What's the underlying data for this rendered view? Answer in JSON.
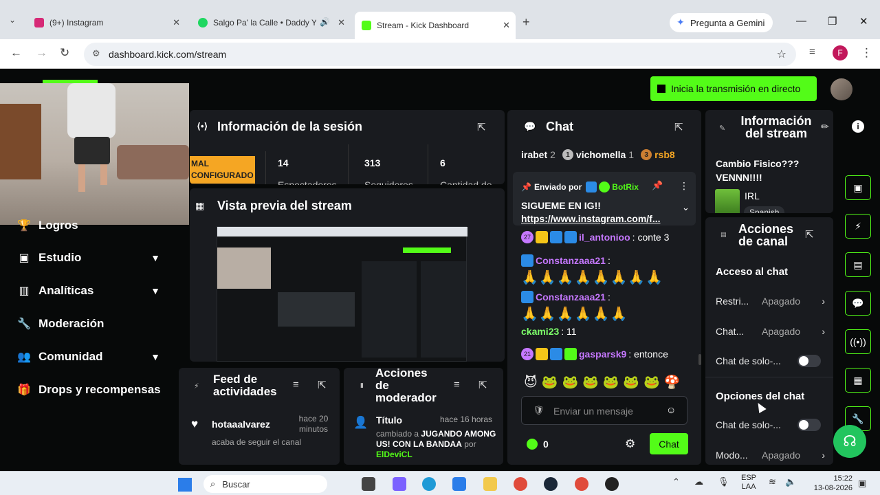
{
  "browser": {
    "tabs": [
      {
        "label": "(9+) Instagram",
        "color": "#d62976"
      },
      {
        "label": "Salgo Pa' la Calle • Daddy Y",
        "color": "#1ed760"
      },
      {
        "label": "Stream - Kick Dashboard",
        "color": "#53fc18"
      }
    ],
    "url": "dashboard.kick.com/stream",
    "gemini_label": "Pregunta a Gemini",
    "profile_initial": "F"
  },
  "header": {
    "go_live_label": "Inicia la transmisión en directo"
  },
  "sidebar": {
    "items": [
      {
        "label": "Logros",
        "icon": "trophy-icon"
      },
      {
        "label": "Estudio",
        "icon": "studio-icon",
        "expandable": true
      },
      {
        "label": "Analíticas",
        "icon": "chart-icon",
        "expandable": true
      },
      {
        "label": "Moderación",
        "icon": "wrench-icon"
      },
      {
        "label": "Comunidad",
        "icon": "users-icon",
        "expandable": true
      },
      {
        "label": "Drops y recompensas",
        "icon": "gift-icon"
      }
    ]
  },
  "session": {
    "title": "Información de la sesión",
    "status_badge": "MAL CONFIGURADO",
    "stats": [
      {
        "value": "14",
        "label": "Espectadores"
      },
      {
        "value": "313",
        "label": "Seguidores"
      },
      {
        "value": "6",
        "label": "Cantidad de"
      }
    ]
  },
  "preview": {
    "title": "Vista previa del stream"
  },
  "activity": {
    "title": "Feed de actividades",
    "items": [
      {
        "user": "hotaaalvarez",
        "time": "hace 20 minutos",
        "text": "acaba de seguir el canal"
      }
    ]
  },
  "mod_actions": {
    "title": "Acciones de moderador",
    "item_title": "Título",
    "item_time": "hace 16 horas",
    "item_text_prefix": "cambiado a",
    "item_text_value": "JUGANDO AMONG US! CON LA BANDAA",
    "item_by": "por",
    "item_user": "ElDeviCL"
  },
  "chat": {
    "title": "Chat",
    "top_users": [
      {
        "name": "irabet",
        "rank": "2"
      },
      {
        "name": "vichomella",
        "rank": "1"
      },
      {
        "name": "rsb8",
        "rank": "3"
      }
    ],
    "pinned": {
      "sent_by_label": "Enviado por",
      "sender": "BotRix",
      "message": "SIGUEME EN IG!!",
      "link": "https://www.instagram.com/f..."
    },
    "messages": [
      {
        "badge": "27",
        "user": "il_antonioo",
        "text": ": conte 3",
        "color": "#c678ff"
      },
      {
        "user": "Constanzaaa21",
        "text": ":",
        "emotes": "🙏🙏🙏🙏🙏🙏🙏🙏",
        "color": "#c678ff"
      },
      {
        "user": "Constanzaaa21",
        "text": ":",
        "emotes": "🙏🙏🙏🙏🙏🙏",
        "color": "#c678ff"
      },
      {
        "user": "ckami23",
        "text": ": 11",
        "color": "#7dff6a"
      },
      {
        "badge": "21",
        "user": "gasparsk9",
        "text": ": entonce",
        "color": "#c678ff"
      }
    ],
    "emote_bar": "😈🐸🐸🐸🐸🐸🐸🍄",
    "input_placeholder": "Enviar un mensaje",
    "points": "0",
    "send_label": "Chat"
  },
  "stream_info": {
    "title": "Información del stream",
    "stream_title": "Cambio Fisico??? VENNN!!!!",
    "category": "IRL",
    "language": "Spanish"
  },
  "channel_actions": {
    "title": "Acciones de canal",
    "sections": [
      {
        "heading": "Acceso al chat",
        "rows": [
          {
            "label": "Restri...",
            "value": "Apagado",
            "type": "link"
          },
          {
            "label": "Chat...",
            "value": "Apagado",
            "type": "link"
          },
          {
            "label": "Chat de solo-...",
            "value": "",
            "type": "toggle"
          }
        ]
      },
      {
        "heading": "Opciones del chat",
        "rows": [
          {
            "label": "Chat de solo-...",
            "value": "",
            "type": "toggle"
          },
          {
            "label": "Modo...",
            "value": "Apagado",
            "type": "link"
          }
        ]
      }
    ]
  },
  "taskbar": {
    "search_label": "Buscar",
    "lang_top": "ESP",
    "lang_bottom": "LAA",
    "time": "15:22",
    "date": "13-08-2026"
  },
  "colors": {
    "accent": "#53fc18",
    "card": "#191b1f"
  }
}
